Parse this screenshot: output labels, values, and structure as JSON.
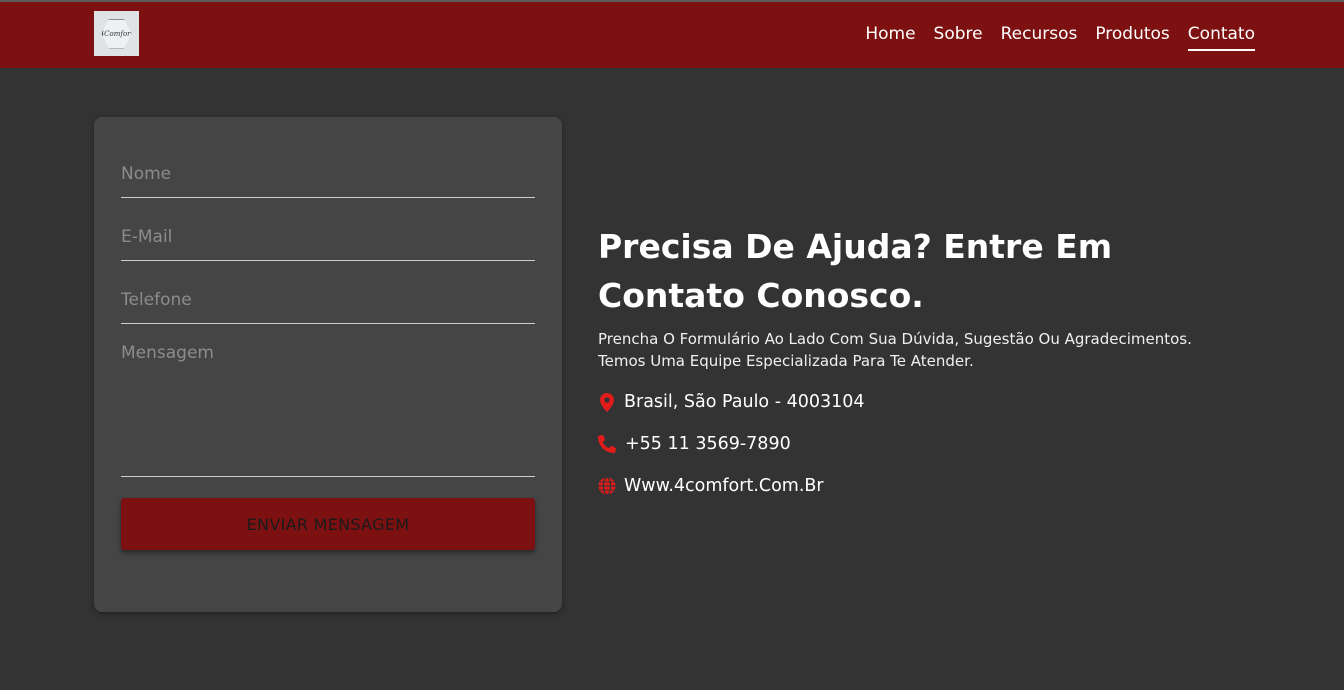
{
  "nav": {
    "logo_text": "4Comfort",
    "links": [
      "Home",
      "Sobre",
      "Recursos",
      "Produtos",
      "Contato"
    ],
    "active": "Contato"
  },
  "form": {
    "nome_placeholder": "Nome",
    "email_placeholder": "E-Mail",
    "telefone_placeholder": "Telefone",
    "mensagem_placeholder": "Mensagem",
    "submit_label": "ENVIAR MENSAGEM"
  },
  "info": {
    "headline_line1": "Precisa De Ajuda? Entre Em",
    "headline_line2": "Contato Conosco.",
    "description_line1": "Prencha O Formulário Ao Lado Com Sua Dúvida, Sugestão Ou Agradecimentos.",
    "description_line2": "Temos Uma Equipe Especializada Para Te Atender.",
    "address": "Brasil, São Paulo - 4003104",
    "phone": "+55 11 3569-7890",
    "website": "Www.4comfort.Com.Br"
  },
  "icons": {
    "address": "map-marker-icon",
    "phone": "phone-icon",
    "website": "globe-icon"
  },
  "colors": {
    "brand_red": "#7d1111",
    "icon_red": "#e21b1b",
    "background": "#333333",
    "card": "#454545"
  }
}
